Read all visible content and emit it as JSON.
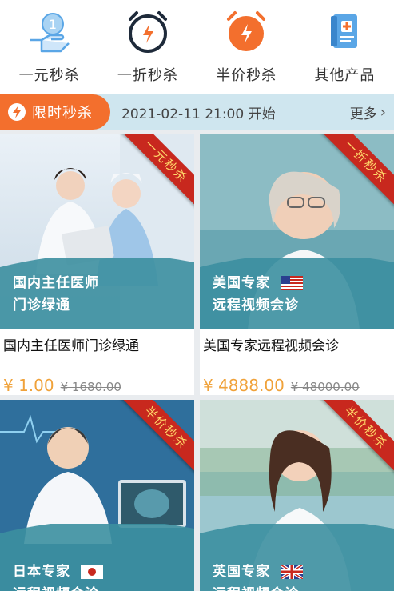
{
  "categories": [
    {
      "label": "一元秒杀",
      "icon": "hand-coin-icon"
    },
    {
      "label": "一折秒杀",
      "icon": "alarm-clock-bolt-icon"
    },
    {
      "label": "半价秒杀",
      "icon": "alarm-clock-bolt-orange-icon"
    },
    {
      "label": "其他产品",
      "icon": "medical-book-icon"
    }
  ],
  "flash_sale": {
    "label": "限时秒杀",
    "time": "2021-02-11 21:00 开始",
    "more": "更多"
  },
  "products": [
    {
      "ribbon": "一元秒杀",
      "overlay_line1": "国内主任医师",
      "overlay_line2": "门诊绿通",
      "flag": "",
      "title": "国内主任医师门诊绿通",
      "price": "¥ 1.00",
      "original_price": "¥ 1680.00"
    },
    {
      "ribbon": "一折秒杀",
      "overlay_line1": "美国专家",
      "overlay_line2": "远程视频会诊",
      "flag": "us-flag-icon",
      "title": "美国专家远程视频会诊",
      "price": "¥ 4888.00",
      "original_price": "¥ 48000.00"
    },
    {
      "ribbon": "半价秒杀",
      "overlay_line1": "日本专家",
      "overlay_line2": "远程视频会诊",
      "flag": "japan-flag-icon"
    },
    {
      "ribbon": "半价秒杀",
      "overlay_line1": "英国专家",
      "overlay_line2": "远程视频会诊",
      "flag": "uk-flag-icon"
    }
  ],
  "colors": {
    "accent_orange": "#f36f2d",
    "banner_blue": "#cfe6ef",
    "price_orange": "#f0a23a",
    "ribbon_red": "#c8281e",
    "overlay_teal": "#3c8fa0"
  }
}
